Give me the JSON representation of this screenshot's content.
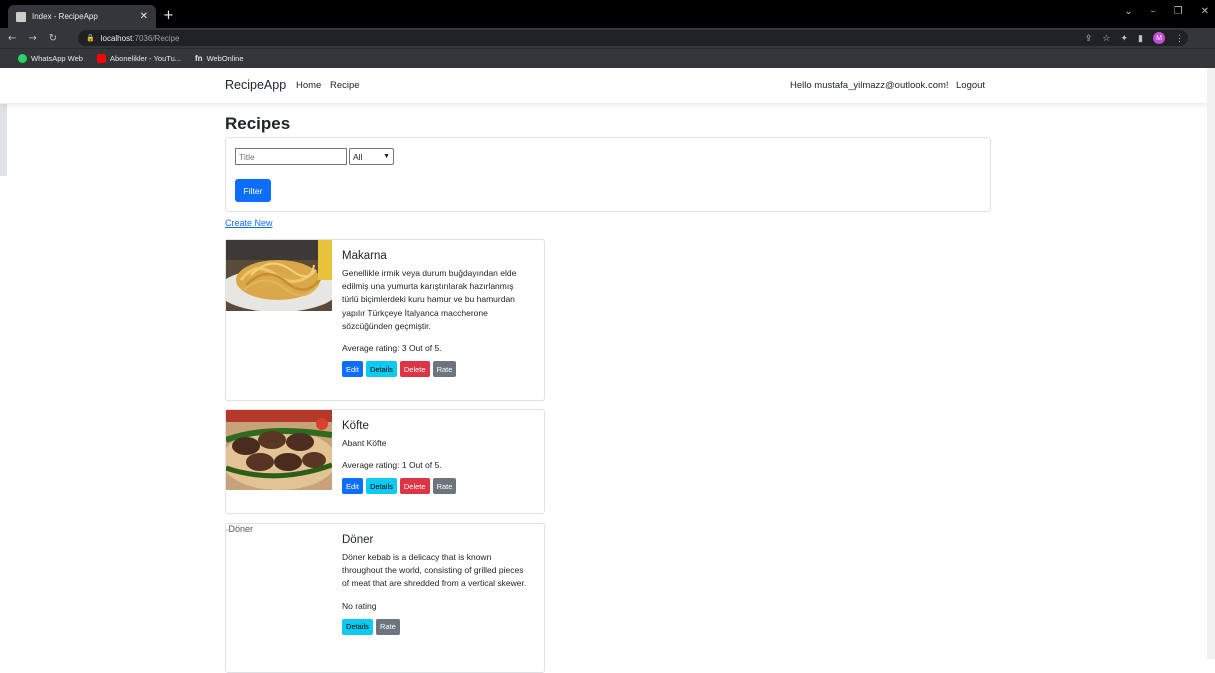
{
  "browser": {
    "tab_title": "Index - RecipeApp",
    "url_host": "localhost",
    "url_path": ":7036/Recipe",
    "profile_initial": "M",
    "bookmarks": [
      {
        "label": "WhatsApp Web",
        "color": "#25d366"
      },
      {
        "label": "Abonelikler - YouTu...",
        "color": "#ff0000"
      },
      {
        "label": "WebOnline",
        "color": "#e8eaed"
      }
    ]
  },
  "navbar": {
    "brand": "RecipeApp",
    "home": "Home",
    "recipe": "Recipe",
    "hello": "Hello mustafa_yilmazz@outlook.com!",
    "logout": "Logout"
  },
  "page": {
    "title": "Recipes",
    "filter": {
      "title_placeholder": "Title",
      "select_value": "All",
      "button_label": "Filter"
    },
    "create_new": "Create New"
  },
  "recipes": [
    {
      "title": "Makarna",
      "description": "Genellikle irmik veya durum buğdayından elde edilmiş una yumurta karıştırılarak hazırlanmış türlü biçimlerdeki kuru hamur ve bu hamurdan yapılır Türkçeye İtalyanca maccherone sözcüğünden geçmiştir.",
      "rating": "Average rating: 3 Out of 5.",
      "buttons": [
        "Edit",
        "Details",
        "Delete",
        "Rate"
      ]
    },
    {
      "title": "Köfte",
      "description": "Abant Köfte",
      "rating": "Average rating: 1 Out of 5.",
      "buttons": [
        "Edit",
        "Details",
        "Delete",
        "Rate"
      ]
    },
    {
      "title": "Döner",
      "image_alt": "Döner",
      "description": "Döner kebab is a delicacy that is known throughout the world, consisting of grilled pieces of meat that are shredded from a vertical skewer.",
      "rating": "No rating",
      "buttons": [
        "Details",
        "Rate"
      ]
    }
  ]
}
